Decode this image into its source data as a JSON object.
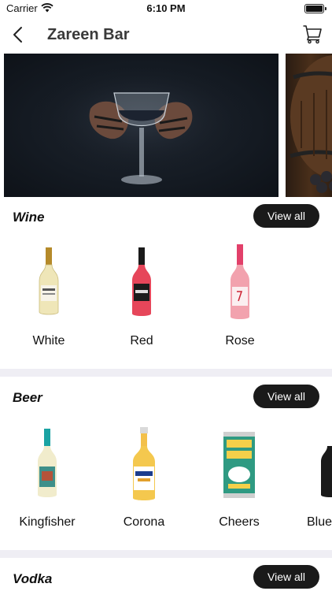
{
  "status_bar": {
    "carrier": "Carrier",
    "time": "6:10 PM"
  },
  "nav": {
    "title": "Zareen Bar",
    "back_icon": "chevron-left-icon",
    "cart_icon": "cart-icon"
  },
  "banners": [
    {
      "name": "wine-glass-banner"
    },
    {
      "name": "barrel-banner"
    }
  ],
  "sections": [
    {
      "title": "Wine",
      "view_all": "View all",
      "products": [
        {
          "name": "White"
        },
        {
          "name": "Red"
        },
        {
          "name": "Rose"
        }
      ]
    },
    {
      "title": "Beer",
      "view_all": "View all",
      "products": [
        {
          "name": "Kingfisher"
        },
        {
          "name": "Corona"
        },
        {
          "name": "Cheers"
        },
        {
          "name": "Blue"
        }
      ]
    },
    {
      "title": "Vodka",
      "view_all": "View all",
      "products": []
    }
  ],
  "colors": {
    "accent": "#1a1a1a",
    "divider": "#efeef4",
    "title_grey": "#3a3a3a"
  }
}
